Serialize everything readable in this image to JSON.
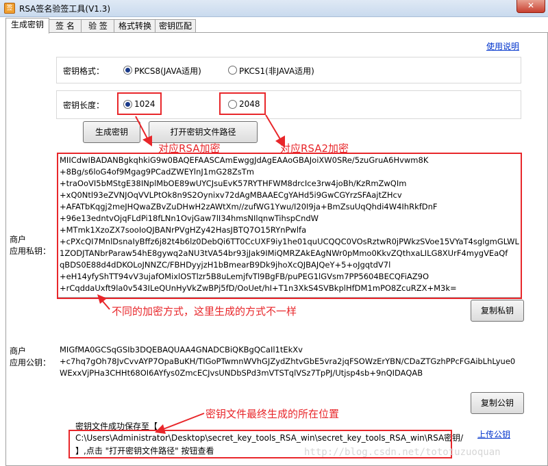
{
  "window": {
    "title": "RSA签名验签工具(V1.3)",
    "app_icon_glyph": "签",
    "close_glyph": "✕"
  },
  "tabs": [
    "生成密钥",
    "签  名",
    "验  签",
    "格式转换",
    "密钥匹配"
  ],
  "help_link": "使用说明",
  "key_format": {
    "label": "密钥格式：",
    "options": [
      "PKCS8(JAVA适用)",
      "PKCS1(非JAVA适用)"
    ],
    "selected": "PKCS8(JAVA适用)"
  },
  "key_length": {
    "label": "密钥长度：",
    "options": [
      "1024",
      "2048"
    ],
    "selected": "1024"
  },
  "buttons": {
    "generate": "生成密钥",
    "open_path": "打开密钥文件路径",
    "copy_private": "复制私钥",
    "copy_public": "复制公钥"
  },
  "private_key": {
    "label_line1": "商户",
    "label_line2": "应用私钥：",
    "lines": [
      "MIICdwIBADANBgkqhkiG9w0BAQEFAASCAmEwggJdAgEAAoGBAJoiXW0SRe/5zuGruA6Hvwm8K",
      "+8Bg/s6loG4of9Mgag9PCadZWEYlnJ1mG28ZsTm",
      "+traOoVI5bMStgE38INplMbOE89wUYCJsuEvK57RYTHFWM8drcIce3rw4joBh/KzRmZwQIm",
      "+xQ0Ntl93eZVNJOqVVLPtOk8n9S2Oynixv72dAgMBAAECgYAHd5i9GwCGYrzSFAajtZHcv",
      "+AFATbKqgj2meJHQwaZBvZuDHwH2zAWtXm//zufWG1Ywu/I20I9ja+BmZsuUqQhdi4W4IhRkfDnF",
      "+96e13edntvOjqFLdPi18fLNn1OvjGaw7lI34hmsNIlqnwTihspCndW",
      "+MTmk1XzoZX7sooIoQJBANrPVgHZy42HasJBTQ7O15RYnPwlfa",
      "+cPXcQI7MnlDsnaIyBffz6j82t4b6lz0DebQi6TT0CcUXF9iy1he01quUCQQC0VOsRztwR0jPWkzSVoe15VYaT4sglgmGLWL",
      "1ZODJTANbrParaw54hE8gywq2aNU3tVA54br93jJak9IMiQMRZAkEAgNWr0pMmo0KkvZQthxaLILG8XUrF4mygVEaQf",
      "qBDS0E88d4dDKOLoJNNZC/FBHDyyjzH1bBmearB9Dk9jhoXcQJBAJQeY+5+oJgqtdV7l",
      "+eH14yfyShTT94vV3ujafOMixlOSTlzr5B8uLemjfvTl9BgFB/puPEG1lGVsm7PP5604BECQFiAZ9O",
      "+rCqddaUxft9la0v543ILeQUnHyVkZwBPj5fD/OoUet/hI+T1n3XkS4SVBkplHfDM1mPO8ZcuRZX+M3k="
    ]
  },
  "public_key": {
    "label_line1": "商户",
    "label_line2": "应用公钥：",
    "lines": [
      "MIGfMA0GCSqGSIb3DQEBAQUAA4GNADCBiQKBgQCaIl1tEkXv",
      "+c7hq7gOh78JvCvvAYP7OpaBuKH/TIGoPTwmnWVhGJZydZhtvGbE5vra2jqFSOWzErYBN/CDaZTGzhPPcFGAibLhLyue0",
      "WExxVjPHa3CHHt68OI6AYfys0ZmcECJvsUNDbSPd3mVTSTqlVSz7TpPJ/Utjsp4sb+9nQIDAQAB"
    ]
  },
  "save_status": {
    "prefix": "密钥文件成功保存至【",
    "path": "C:\\Users\\Administrator\\Desktop\\secret_key_tools_RSA_win\\secret_key_tools_RSA_win\\RSA密钥/",
    "suffix": "】,点击 \"打开密钥文件路径\" 按钮查看"
  },
  "upload_link": "上传公钥",
  "annotations": {
    "rsa1024": "对应RSA加密",
    "rsa2048": "对应RSA2加密",
    "different_methods": "不同的加密方式，这里生成的方式不一样",
    "file_location": "密钥文件最终生成的所在位置"
  },
  "watermark": "http://blog.csdn.net/tototuzuoquan",
  "colors": {
    "annotation_red": "#e8262a",
    "link_blue": "#0033cc",
    "radio_dot": "#1a3a8a"
  }
}
